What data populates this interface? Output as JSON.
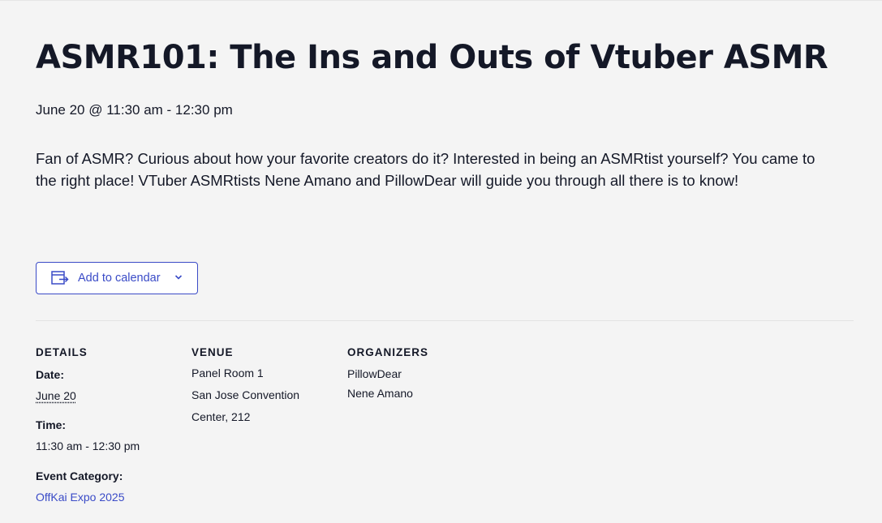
{
  "event": {
    "title": "ASMR101: The Ins and Outs of Vtuber ASMR",
    "datetime": "June 20 @ 11:30 am - 12:30 pm",
    "description": "Fan of ASMR? Curious about how your favorite creators do it? Interested in being an ASMRtist yourself? You came to the right place! VTuber ASMRtists Nene Amano and PillowDear will guide you through all there is to know!"
  },
  "calendar_button": {
    "label": "Add to calendar",
    "icon": "calendar-export-icon",
    "chevron": "chevron-down-icon"
  },
  "details": {
    "heading": "DETAILS",
    "date_label": "Date:",
    "date_value": "June 20",
    "time_label": "Time:",
    "time_value": "11:30 am - 12:30 pm",
    "category_label": "Event Category:",
    "category_value": "OffKai Expo 2025"
  },
  "venue": {
    "heading": "VENUE",
    "line1": "Panel Room 1",
    "line2": "San Jose Convention",
    "line3": "Center, 212"
  },
  "organizers": {
    "heading": "ORGANIZERS",
    "items": [
      "PillowDear",
      "Nene Amano"
    ]
  },
  "colors": {
    "background": "#f4f4f4",
    "text": "#141827",
    "accent": "#3a4bc7",
    "divider": "#e2e2e2"
  }
}
